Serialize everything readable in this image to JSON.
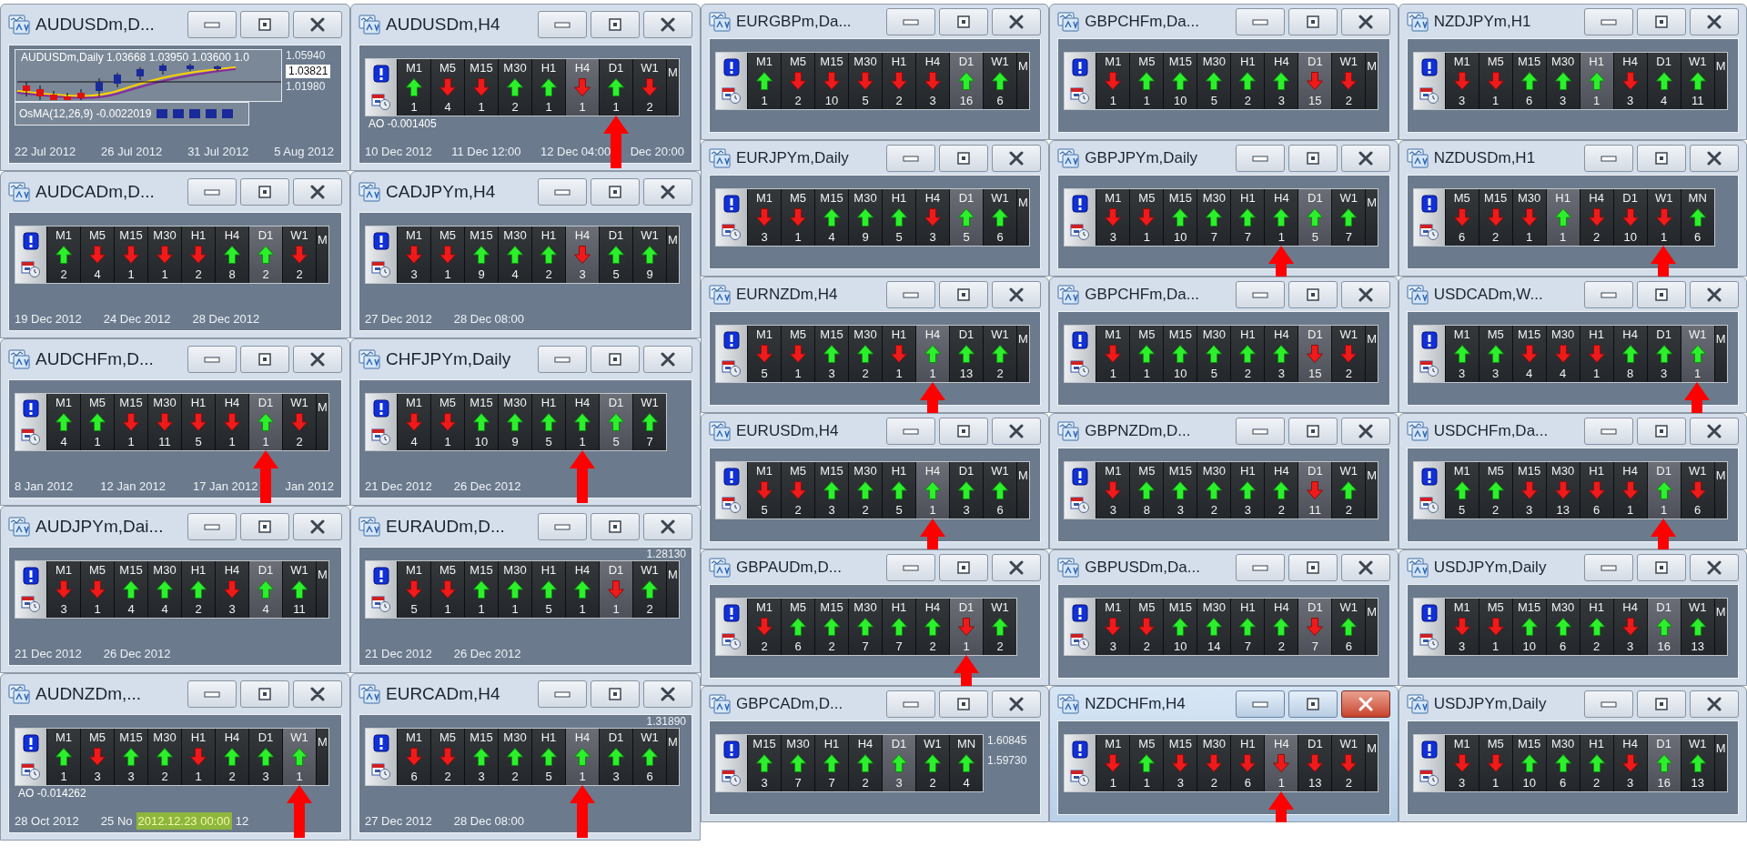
{
  "left_windows": [
    {
      "kind": "chart",
      "title": "AUDUSDm,D...",
      "active": false,
      "header": "AUDUSDm,Daily  1.03668 1.03950 1.03600 1.0",
      "scale": [
        {
          "text": "1.05940",
          "current": false
        },
        {
          "text": "1.03821",
          "current": true
        },
        {
          "text": "1.01980",
          "current": false
        }
      ],
      "indicator": "OsMA(12,26,9) -0.0022019",
      "dates": [
        "22 Jul 2012",
        "26 Jul 2012",
        "31 Jul 2012",
        "5 Aug 2012"
      ]
    },
    {
      "kind": "panel",
      "title": "AUDUSDm,H4",
      "active": false,
      "cells": [
        {
          "tf": "M1",
          "up": true,
          "count": "1",
          "current": false,
          "flagged": false
        },
        {
          "tf": "M5",
          "up": false,
          "count": "4",
          "current": false,
          "flagged": false
        },
        {
          "tf": "M15",
          "up": false,
          "count": "1",
          "current": false,
          "flagged": false
        },
        {
          "tf": "M30",
          "up": true,
          "count": "2",
          "current": false,
          "flagged": false
        },
        {
          "tf": "H1",
          "up": true,
          "count": "1",
          "current": false,
          "flagged": false
        },
        {
          "tf": "H4",
          "up": false,
          "count": "1",
          "current": true,
          "flagged": false
        },
        {
          "tf": "D1",
          "up": true,
          "count": "1",
          "current": false,
          "flagged": true
        },
        {
          "tf": "W1",
          "up": false,
          "count": "2",
          "current": false,
          "flagged": false
        }
      ],
      "edge_label": "M",
      "indicator": "AO -0.001405",
      "dates": [
        "10 Dec 2012",
        "11 Dec 12:00",
        "12 Dec 04:00",
        "Dec 20:00"
      ]
    },
    {
      "kind": "panel",
      "title": "AUDCADm,D...",
      "active": false,
      "cells": [
        {
          "tf": "M1",
          "up": true,
          "count": "2",
          "current": false,
          "flagged": false
        },
        {
          "tf": "M5",
          "up": false,
          "count": "4",
          "current": false,
          "flagged": false
        },
        {
          "tf": "M15",
          "up": false,
          "count": "1",
          "current": false,
          "flagged": false
        },
        {
          "tf": "M30",
          "up": false,
          "count": "1",
          "current": false,
          "flagged": false
        },
        {
          "tf": "H1",
          "up": false,
          "count": "2",
          "current": false,
          "flagged": false
        },
        {
          "tf": "H4",
          "up": true,
          "count": "8",
          "current": false,
          "flagged": false
        },
        {
          "tf": "D1",
          "up": true,
          "count": "2",
          "current": true,
          "flagged": false
        },
        {
          "tf": "W1",
          "up": false,
          "count": "2",
          "current": false,
          "flagged": false
        }
      ],
      "edge_label": "M",
      "dates": [
        "19 Dec 2012",
        "24 Dec 2012",
        "28 Dec 2012"
      ]
    },
    {
      "kind": "panel",
      "title": "CADJPYm,H4",
      "active": false,
      "cells": [
        {
          "tf": "M1",
          "up": false,
          "count": "3",
          "current": false,
          "flagged": false
        },
        {
          "tf": "M5",
          "up": false,
          "count": "1",
          "current": false,
          "flagged": false
        },
        {
          "tf": "M15",
          "up": true,
          "count": "9",
          "current": false,
          "flagged": false
        },
        {
          "tf": "M30",
          "up": true,
          "count": "4",
          "current": false,
          "flagged": false
        },
        {
          "tf": "H1",
          "up": true,
          "count": "2",
          "current": false,
          "flagged": false
        },
        {
          "tf": "H4",
          "up": false,
          "count": "3",
          "current": true,
          "flagged": false
        },
        {
          "tf": "D1",
          "up": true,
          "count": "5",
          "current": false,
          "flagged": false
        },
        {
          "tf": "W1",
          "up": true,
          "count": "9",
          "current": false,
          "flagged": false
        }
      ],
      "edge_label": "M",
      "dates": [
        "27 Dec 2012",
        "28 Dec 08:00"
      ]
    },
    {
      "kind": "panel",
      "title": "AUDCHFm,D...",
      "active": false,
      "cells": [
        {
          "tf": "M1",
          "up": true,
          "count": "4",
          "current": false,
          "flagged": false
        },
        {
          "tf": "M5",
          "up": true,
          "count": "1",
          "current": false,
          "flagged": false
        },
        {
          "tf": "M15",
          "up": false,
          "count": "1",
          "current": false,
          "flagged": false
        },
        {
          "tf": "M30",
          "up": false,
          "count": "11",
          "current": false,
          "flagged": false
        },
        {
          "tf": "H1",
          "up": false,
          "count": "5",
          "current": false,
          "flagged": false
        },
        {
          "tf": "H4",
          "up": false,
          "count": "1",
          "current": false,
          "flagged": false
        },
        {
          "tf": "D1",
          "up": true,
          "count": "1",
          "current": true,
          "flagged": true
        },
        {
          "tf": "W1",
          "up": false,
          "count": "2",
          "current": false,
          "flagged": false
        }
      ],
      "edge_label": "M",
      "dates": [
        "8 Jan 2012",
        "12 Jan 2012",
        "17 Jan 2012",
        "Jan 2012"
      ]
    },
    {
      "kind": "panel",
      "title": "CHFJPYm,Daily",
      "active": false,
      "cells": [
        {
          "tf": "M1",
          "up": false,
          "count": "4",
          "current": false,
          "flagged": false
        },
        {
          "tf": "M5",
          "up": false,
          "count": "1",
          "current": false,
          "flagged": false
        },
        {
          "tf": "M15",
          "up": true,
          "count": "10",
          "current": false,
          "flagged": false
        },
        {
          "tf": "M30",
          "up": true,
          "count": "9",
          "current": false,
          "flagged": false
        },
        {
          "tf": "H1",
          "up": true,
          "count": "5",
          "current": false,
          "flagged": false
        },
        {
          "tf": "H4",
          "up": true,
          "count": "1",
          "current": false,
          "flagged": true
        },
        {
          "tf": "D1",
          "up": true,
          "count": "5",
          "current": true,
          "flagged": false
        },
        {
          "tf": "W1",
          "up": true,
          "count": "7",
          "current": false,
          "flagged": false
        }
      ],
      "dates": [
        "21 Dec 2012",
        "26 Dec 2012"
      ]
    },
    {
      "kind": "panel",
      "title": "AUDJPYm,Dai...",
      "active": false,
      "cells": [
        {
          "tf": "M1",
          "up": false,
          "count": "3",
          "current": false,
          "flagged": false
        },
        {
          "tf": "M5",
          "up": false,
          "count": "1",
          "current": false,
          "flagged": false
        },
        {
          "tf": "M15",
          "up": true,
          "count": "4",
          "current": false,
          "flagged": false
        },
        {
          "tf": "M30",
          "up": true,
          "count": "4",
          "current": false,
          "flagged": false
        },
        {
          "tf": "H1",
          "up": true,
          "count": "2",
          "current": false,
          "flagged": false
        },
        {
          "tf": "H4",
          "up": false,
          "count": "3",
          "current": false,
          "flagged": false
        },
        {
          "tf": "D1",
          "up": true,
          "count": "4",
          "current": true,
          "flagged": false
        },
        {
          "tf": "W1",
          "up": true,
          "count": "11",
          "current": false,
          "flagged": false
        }
      ],
      "edge_label": "M",
      "dates": [
        "21 Dec 2012",
        "26 Dec 2012"
      ]
    },
    {
      "kind": "panel",
      "title": "EURAUDm,D...",
      "active": false,
      "prices": [
        "1.28130"
      ],
      "cells": [
        {
          "tf": "M1",
          "up": false,
          "count": "5",
          "current": false,
          "flagged": false
        },
        {
          "tf": "M5",
          "up": false,
          "count": "1",
          "current": false,
          "flagged": false
        },
        {
          "tf": "M15",
          "up": true,
          "count": "1",
          "current": false,
          "flagged": false
        },
        {
          "tf": "M30",
          "up": true,
          "count": "1",
          "current": false,
          "flagged": false
        },
        {
          "tf": "H1",
          "up": true,
          "count": "5",
          "current": false,
          "flagged": false
        },
        {
          "tf": "H4",
          "up": true,
          "count": "1",
          "current": false,
          "flagged": false
        },
        {
          "tf": "D1",
          "up": false,
          "count": "1",
          "current": true,
          "flagged": false
        },
        {
          "tf": "W1",
          "up": true,
          "count": "2",
          "current": false,
          "flagged": false
        }
      ],
      "edge_label": "M",
      "dates": [
        "21 Dec 2012",
        "26 Dec 2012"
      ]
    },
    {
      "kind": "panel",
      "title": "AUDNZDm,...",
      "active": false,
      "cells": [
        {
          "tf": "M1",
          "up": true,
          "count": "1",
          "current": false,
          "flagged": false
        },
        {
          "tf": "M5",
          "up": false,
          "count": "3",
          "current": false,
          "flagged": false
        },
        {
          "tf": "M15",
          "up": true,
          "count": "3",
          "current": false,
          "flagged": false
        },
        {
          "tf": "M30",
          "up": true,
          "count": "2",
          "current": false,
          "flagged": false
        },
        {
          "tf": "H1",
          "up": false,
          "count": "1",
          "current": false,
          "flagged": false
        },
        {
          "tf": "H4",
          "up": true,
          "count": "2",
          "current": false,
          "flagged": false
        },
        {
          "tf": "D1",
          "up": true,
          "count": "3",
          "current": false,
          "flagged": false
        },
        {
          "tf": "W1",
          "up": true,
          "count": "1",
          "current": true,
          "flagged": true
        }
      ],
      "edge_label": "M",
      "indicator": "AO -0.014262",
      "dates": [
        "28 Oct 2012",
        "25 No",
        "12"
      ],
      "crosshair": "2012.12.23 00:00"
    },
    {
      "kind": "panel",
      "title": "EURCADm,H4",
      "active": false,
      "prices": [
        "1.31890"
      ],
      "cells": [
        {
          "tf": "M1",
          "up": false,
          "count": "6",
          "current": false,
          "flagged": false
        },
        {
          "tf": "M5",
          "up": false,
          "count": "2",
          "current": false,
          "flagged": false
        },
        {
          "tf": "M15",
          "up": true,
          "count": "3",
          "current": false,
          "flagged": false
        },
        {
          "tf": "M30",
          "up": true,
          "count": "2",
          "current": false,
          "flagged": false
        },
        {
          "tf": "H1",
          "up": true,
          "count": "5",
          "current": false,
          "flagged": false
        },
        {
          "tf": "H4",
          "up": true,
          "count": "1",
          "current": true,
          "flagged": true
        },
        {
          "tf": "D1",
          "up": true,
          "count": "3",
          "current": false,
          "flagged": false
        },
        {
          "tf": "W1",
          "up": true,
          "count": "6",
          "current": false,
          "flagged": false
        }
      ],
      "edge_label": "M",
      "dates": [
        "27 Dec 2012",
        "28 Dec 08:00"
      ]
    }
  ],
  "right_windows": [
    {
      "kind": "panel",
      "title": "EURGBPm,Da...",
      "active": false,
      "cells": [
        {
          "tf": "M1",
          "up": true,
          "count": "1",
          "current": false,
          "flagged": false
        },
        {
          "tf": "M5",
          "up": false,
          "count": "2",
          "current": false,
          "flagged": false
        },
        {
          "tf": "M15",
          "up": false,
          "count": "10",
          "current": false,
          "flagged": false
        },
        {
          "tf": "M30",
          "up": false,
          "count": "5",
          "current": false,
          "flagged": false
        },
        {
          "tf": "H1",
          "up": false,
          "count": "2",
          "current": false,
          "flagged": false
        },
        {
          "tf": "H4",
          "up": false,
          "count": "3",
          "current": false,
          "flagged": false
        },
        {
          "tf": "D1",
          "up": true,
          "count": "16",
          "current": true,
          "flagged": false
        },
        {
          "tf": "W1",
          "up": true,
          "count": "6",
          "current": false,
          "flagged": false
        }
      ],
      "edge_label": "M"
    },
    {
      "kind": "panel",
      "title": "GBPCHFm,Da...",
      "active": false,
      "cells": [
        {
          "tf": "M1",
          "up": false,
          "count": "1",
          "current": false,
          "flagged": false
        },
        {
          "tf": "M5",
          "up": true,
          "count": "1",
          "current": false,
          "flagged": false
        },
        {
          "tf": "M15",
          "up": true,
          "count": "10",
          "current": false,
          "flagged": false
        },
        {
          "tf": "M30",
          "up": true,
          "count": "5",
          "current": false,
          "flagged": false
        },
        {
          "tf": "H1",
          "up": true,
          "count": "2",
          "current": false,
          "flagged": false
        },
        {
          "tf": "H4",
          "up": true,
          "count": "3",
          "current": false,
          "flagged": false
        },
        {
          "tf": "D1",
          "up": false,
          "count": "15",
          "current": true,
          "flagged": false
        },
        {
          "tf": "W1",
          "up": false,
          "count": "2",
          "current": false,
          "flagged": false
        }
      ],
      "edge_label": "M"
    },
    {
      "kind": "panel",
      "title": "NZDJPYm,H1",
      "active": false,
      "cells": [
        {
          "tf": "M1",
          "up": false,
          "count": "3",
          "current": false,
          "flagged": false
        },
        {
          "tf": "M5",
          "up": false,
          "count": "1",
          "current": false,
          "flagged": false
        },
        {
          "tf": "M15",
          "up": true,
          "count": "6",
          "current": false,
          "flagged": false
        },
        {
          "tf": "M30",
          "up": true,
          "count": "3",
          "current": false,
          "flagged": false
        },
        {
          "tf": "H1",
          "up": true,
          "count": "1",
          "current": true,
          "flagged": false
        },
        {
          "tf": "H4",
          "up": false,
          "count": "3",
          "current": false,
          "flagged": false
        },
        {
          "tf": "D1",
          "up": true,
          "count": "4",
          "current": false,
          "flagged": false
        },
        {
          "tf": "W1",
          "up": true,
          "count": "11",
          "current": false,
          "flagged": false
        }
      ],
      "edge_label": "M"
    },
    {
      "kind": "panel",
      "title": "EURJPYm,Daily",
      "active": false,
      "cells": [
        {
          "tf": "M1",
          "up": false,
          "count": "3",
          "current": false,
          "flagged": false
        },
        {
          "tf": "M5",
          "up": false,
          "count": "1",
          "current": false,
          "flagged": false
        },
        {
          "tf": "M15",
          "up": true,
          "count": "4",
          "current": false,
          "flagged": false
        },
        {
          "tf": "M30",
          "up": true,
          "count": "9",
          "current": false,
          "flagged": false
        },
        {
          "tf": "H1",
          "up": true,
          "count": "5",
          "current": false,
          "flagged": false
        },
        {
          "tf": "H4",
          "up": false,
          "count": "3",
          "current": false,
          "flagged": false
        },
        {
          "tf": "D1",
          "up": true,
          "count": "5",
          "current": true,
          "flagged": false
        },
        {
          "tf": "W1",
          "up": true,
          "count": "6",
          "current": false,
          "flagged": false
        }
      ],
      "edge_label": "M"
    },
    {
      "kind": "panel",
      "title": "GBPJPYm,Daily",
      "active": false,
      "cells": [
        {
          "tf": "M1",
          "up": false,
          "count": "3",
          "current": false,
          "flagged": false
        },
        {
          "tf": "M5",
          "up": false,
          "count": "1",
          "current": false,
          "flagged": false
        },
        {
          "tf": "M15",
          "up": true,
          "count": "10",
          "current": false,
          "flagged": false
        },
        {
          "tf": "M30",
          "up": true,
          "count": "7",
          "current": false,
          "flagged": false
        },
        {
          "tf": "H1",
          "up": true,
          "count": "7",
          "current": false,
          "flagged": false
        },
        {
          "tf": "H4",
          "up": true,
          "count": "1",
          "current": false,
          "flagged": true
        },
        {
          "tf": "D1",
          "up": true,
          "count": "5",
          "current": true,
          "flagged": false
        },
        {
          "tf": "W1",
          "up": true,
          "count": "7",
          "current": false,
          "flagged": false
        }
      ],
      "edge_label": "M"
    },
    {
      "kind": "panel",
      "title": "NZDUSDm,H1",
      "active": false,
      "cells": [
        {
          "tf": "M5",
          "up": false,
          "count": "6",
          "current": false,
          "flagged": false
        },
        {
          "tf": "M15",
          "up": false,
          "count": "2",
          "current": false,
          "flagged": false
        },
        {
          "tf": "M30",
          "up": false,
          "count": "1",
          "current": false,
          "flagged": false
        },
        {
          "tf": "H1",
          "up": true,
          "count": "1",
          "current": true,
          "flagged": false
        },
        {
          "tf": "H4",
          "up": false,
          "count": "2",
          "current": false,
          "flagged": false
        },
        {
          "tf": "D1",
          "up": false,
          "count": "10",
          "current": false,
          "flagged": false
        },
        {
          "tf": "W1",
          "up": false,
          "count": "1",
          "current": false,
          "flagged": true
        },
        {
          "tf": "MN",
          "up": true,
          "count": "6",
          "current": false,
          "flagged": false
        }
      ]
    },
    {
      "kind": "panel",
      "title": "EURNZDm,H4",
      "active": false,
      "cells": [
        {
          "tf": "M1",
          "up": false,
          "count": "5",
          "current": false,
          "flagged": false
        },
        {
          "tf": "M5",
          "up": false,
          "count": "1",
          "current": false,
          "flagged": false
        },
        {
          "tf": "M15",
          "up": true,
          "count": "3",
          "current": false,
          "flagged": false
        },
        {
          "tf": "M30",
          "up": true,
          "count": "2",
          "current": false,
          "flagged": false
        },
        {
          "tf": "H1",
          "up": false,
          "count": "1",
          "current": false,
          "flagged": false
        },
        {
          "tf": "H4",
          "up": true,
          "count": "1",
          "current": true,
          "flagged": true
        },
        {
          "tf": "D1",
          "up": true,
          "count": "13",
          "current": false,
          "flagged": false
        },
        {
          "tf": "W1",
          "up": true,
          "count": "2",
          "current": false,
          "flagged": false
        }
      ],
      "edge_label": "M"
    },
    {
      "kind": "panel",
      "title": "GBPCHFm,Da...",
      "active": false,
      "cells": [
        {
          "tf": "M1",
          "up": false,
          "count": "1",
          "current": false,
          "flagged": false
        },
        {
          "tf": "M5",
          "up": true,
          "count": "1",
          "current": false,
          "flagged": false
        },
        {
          "tf": "M15",
          "up": true,
          "count": "10",
          "current": false,
          "flagged": false
        },
        {
          "tf": "M30",
          "up": true,
          "count": "5",
          "current": false,
          "flagged": false
        },
        {
          "tf": "H1",
          "up": true,
          "count": "2",
          "current": false,
          "flagged": false
        },
        {
          "tf": "H4",
          "up": true,
          "count": "3",
          "current": false,
          "flagged": false
        },
        {
          "tf": "D1",
          "up": false,
          "count": "15",
          "current": true,
          "flagged": false
        },
        {
          "tf": "W1",
          "up": false,
          "count": "2",
          "current": false,
          "flagged": false
        }
      ],
      "edge_label": "M"
    },
    {
      "kind": "panel",
      "title": "USDCADm,W...",
      "active": false,
      "cells": [
        {
          "tf": "M1",
          "up": true,
          "count": "3",
          "current": false,
          "flagged": false
        },
        {
          "tf": "M5",
          "up": true,
          "count": "3",
          "current": false,
          "flagged": false
        },
        {
          "tf": "M15",
          "up": false,
          "count": "4",
          "current": false,
          "flagged": false
        },
        {
          "tf": "M30",
          "up": false,
          "count": "4",
          "current": false,
          "flagged": false
        },
        {
          "tf": "H1",
          "up": false,
          "count": "1",
          "current": false,
          "flagged": false
        },
        {
          "tf": "H4",
          "up": true,
          "count": "8",
          "current": false,
          "flagged": false
        },
        {
          "tf": "D1",
          "up": true,
          "count": "3",
          "current": false,
          "flagged": false
        },
        {
          "tf": "W1",
          "up": true,
          "count": "1",
          "current": true,
          "flagged": true
        }
      ],
      "edge_label": "M"
    },
    {
      "kind": "panel",
      "title": "EURUSDm,H4",
      "active": false,
      "cells": [
        {
          "tf": "M1",
          "up": false,
          "count": "5",
          "current": false,
          "flagged": false
        },
        {
          "tf": "M5",
          "up": false,
          "count": "2",
          "current": false,
          "flagged": false
        },
        {
          "tf": "M15",
          "up": true,
          "count": "3",
          "current": false,
          "flagged": false
        },
        {
          "tf": "M30",
          "up": true,
          "count": "2",
          "current": false,
          "flagged": false
        },
        {
          "tf": "H1",
          "up": true,
          "count": "5",
          "current": false,
          "flagged": false
        },
        {
          "tf": "H4",
          "up": true,
          "count": "1",
          "current": true,
          "flagged": true
        },
        {
          "tf": "D1",
          "up": true,
          "count": "3",
          "current": false,
          "flagged": false
        },
        {
          "tf": "W1",
          "up": true,
          "count": "6",
          "current": false,
          "flagged": false
        }
      ],
      "edge_label": "M"
    },
    {
      "kind": "panel",
      "title": "GBPNZDm,D...",
      "active": false,
      "cells": [
        {
          "tf": "M1",
          "up": false,
          "count": "3",
          "current": false,
          "flagged": false
        },
        {
          "tf": "M5",
          "up": true,
          "count": "8",
          "current": false,
          "flagged": false
        },
        {
          "tf": "M15",
          "up": true,
          "count": "3",
          "current": false,
          "flagged": false
        },
        {
          "tf": "M30",
          "up": true,
          "count": "2",
          "current": false,
          "flagged": false
        },
        {
          "tf": "H1",
          "up": true,
          "count": "3",
          "current": false,
          "flagged": false
        },
        {
          "tf": "H4",
          "up": true,
          "count": "2",
          "current": false,
          "flagged": false
        },
        {
          "tf": "D1",
          "up": false,
          "count": "11",
          "current": true,
          "flagged": false
        },
        {
          "tf": "W1",
          "up": true,
          "count": "2",
          "current": false,
          "flagged": false
        }
      ],
      "edge_label": "M"
    },
    {
      "kind": "panel",
      "title": "USDCHFm,Da...",
      "active": false,
      "cells": [
        {
          "tf": "M1",
          "up": true,
          "count": "5",
          "current": false,
          "flagged": false
        },
        {
          "tf": "M5",
          "up": true,
          "count": "2",
          "current": false,
          "flagged": false
        },
        {
          "tf": "M15",
          "up": false,
          "count": "3",
          "current": false,
          "flagged": false
        },
        {
          "tf": "M30",
          "up": false,
          "count": "13",
          "current": false,
          "flagged": false
        },
        {
          "tf": "H1",
          "up": false,
          "count": "6",
          "current": false,
          "flagged": false
        },
        {
          "tf": "H4",
          "up": false,
          "count": "1",
          "current": false,
          "flagged": false
        },
        {
          "tf": "D1",
          "up": true,
          "count": "1",
          "current": true,
          "flagged": true
        },
        {
          "tf": "W1",
          "up": false,
          "count": "6",
          "current": false,
          "flagged": false
        }
      ],
      "edge_label": "M"
    },
    {
      "kind": "panel",
      "title": "GBPAUDm,D...",
      "active": false,
      "cells": [
        {
          "tf": "M1",
          "up": false,
          "count": "2",
          "current": false,
          "flagged": false
        },
        {
          "tf": "M5",
          "up": true,
          "count": "6",
          "current": false,
          "flagged": false
        },
        {
          "tf": "M15",
          "up": true,
          "count": "2",
          "current": false,
          "flagged": false
        },
        {
          "tf": "M30",
          "up": true,
          "count": "7",
          "current": false,
          "flagged": false
        },
        {
          "tf": "H1",
          "up": true,
          "count": "7",
          "current": false,
          "flagged": false
        },
        {
          "tf": "H4",
          "up": true,
          "count": "2",
          "current": false,
          "flagged": false
        },
        {
          "tf": "D1",
          "up": false,
          "count": "1",
          "current": true,
          "flagged": true
        },
        {
          "tf": "W1",
          "up": true,
          "count": "2",
          "current": false,
          "flagged": false
        }
      ]
    },
    {
      "kind": "panel",
      "title": "GBPUSDm,Da...",
      "active": false,
      "cells": [
        {
          "tf": "M1",
          "up": false,
          "count": "3",
          "current": false,
          "flagged": false
        },
        {
          "tf": "M5",
          "up": false,
          "count": "2",
          "current": false,
          "flagged": false
        },
        {
          "tf": "M15",
          "up": true,
          "count": "10",
          "current": false,
          "flagged": false
        },
        {
          "tf": "M30",
          "up": true,
          "count": "14",
          "current": false,
          "flagged": false
        },
        {
          "tf": "H1",
          "up": true,
          "count": "7",
          "current": false,
          "flagged": false
        },
        {
          "tf": "H4",
          "up": true,
          "count": "2",
          "current": false,
          "flagged": false
        },
        {
          "tf": "D1",
          "up": false,
          "count": "7",
          "current": true,
          "flagged": false
        },
        {
          "tf": "W1",
          "up": true,
          "count": "6",
          "current": false,
          "flagged": false
        }
      ],
      "edge_label": "M"
    },
    {
      "kind": "panel",
      "title": "USDJPYm,Daily",
      "active": false,
      "cells": [
        {
          "tf": "M1",
          "up": false,
          "count": "3",
          "current": false,
          "flagged": false
        },
        {
          "tf": "M5",
          "up": false,
          "count": "1",
          "current": false,
          "flagged": false
        },
        {
          "tf": "M15",
          "up": true,
          "count": "10",
          "current": false,
          "flagged": false
        },
        {
          "tf": "M30",
          "up": true,
          "count": "6",
          "current": false,
          "flagged": false
        },
        {
          "tf": "H1",
          "up": true,
          "count": "2",
          "current": false,
          "flagged": false
        },
        {
          "tf": "H4",
          "up": false,
          "count": "3",
          "current": false,
          "flagged": false
        },
        {
          "tf": "D1",
          "up": true,
          "count": "16",
          "current": true,
          "flagged": false
        },
        {
          "tf": "W1",
          "up": true,
          "count": "13",
          "current": false,
          "flagged": false
        }
      ],
      "edge_label": "M"
    },
    {
      "kind": "panel",
      "title": "GBPCADm,D...",
      "active": false,
      "prices": [
        "1.60845",
        "1.59730"
      ],
      "cells": [
        {
          "tf": "M15",
          "up": true,
          "count": "3",
          "current": false,
          "flagged": false
        },
        {
          "tf": "M30",
          "up": true,
          "count": "7",
          "current": false,
          "flagged": false
        },
        {
          "tf": "H1",
          "up": true,
          "count": "7",
          "current": false,
          "flagged": false
        },
        {
          "tf": "H4",
          "up": true,
          "count": "2",
          "current": false,
          "flagged": false
        },
        {
          "tf": "D1",
          "up": true,
          "count": "3",
          "current": true,
          "flagged": false
        },
        {
          "tf": "W1",
          "up": true,
          "count": "2",
          "current": false,
          "flagged": false
        },
        {
          "tf": "MN",
          "up": true,
          "count": "4",
          "current": false,
          "flagged": false
        }
      ]
    },
    {
      "kind": "panel",
      "title": "NZDCHFm,H4",
      "active": true,
      "cells": [
        {
          "tf": "M1",
          "up": false,
          "count": "1",
          "current": false,
          "flagged": false
        },
        {
          "tf": "M5",
          "up": true,
          "count": "1",
          "current": false,
          "flagged": false
        },
        {
          "tf": "M15",
          "up": false,
          "count": "3",
          "current": false,
          "flagged": false
        },
        {
          "tf": "M30",
          "up": false,
          "count": "2",
          "current": false,
          "flagged": false
        },
        {
          "tf": "H1",
          "up": false,
          "count": "6",
          "current": false,
          "flagged": false
        },
        {
          "tf": "H4",
          "up": false,
          "count": "1",
          "current": true,
          "flagged": true
        },
        {
          "tf": "D1",
          "up": false,
          "count": "13",
          "current": false,
          "flagged": false
        },
        {
          "tf": "W1",
          "up": false,
          "count": "2",
          "current": false,
          "flagged": false
        }
      ],
      "edge_label": "M"
    },
    {
      "kind": "panel",
      "title": "USDJPYm,Daily",
      "active": false,
      "cells": [
        {
          "tf": "M1",
          "up": false,
          "count": "3",
          "current": false,
          "flagged": false
        },
        {
          "tf": "M5",
          "up": false,
          "count": "1",
          "current": false,
          "flagged": false
        },
        {
          "tf": "M15",
          "up": true,
          "count": "10",
          "current": false,
          "flagged": false
        },
        {
          "tf": "M30",
          "up": true,
          "count": "6",
          "current": false,
          "flagged": false
        },
        {
          "tf": "H1",
          "up": true,
          "count": "2",
          "current": false,
          "flagged": false
        },
        {
          "tf": "H4",
          "up": false,
          "count": "3",
          "current": false,
          "flagged": false
        },
        {
          "tf": "D1",
          "up": true,
          "count": "16",
          "current": true,
          "flagged": false
        },
        {
          "tf": "W1",
          "up": true,
          "count": "13",
          "current": false,
          "flagged": false
        }
      ],
      "edge_label": "M"
    }
  ]
}
